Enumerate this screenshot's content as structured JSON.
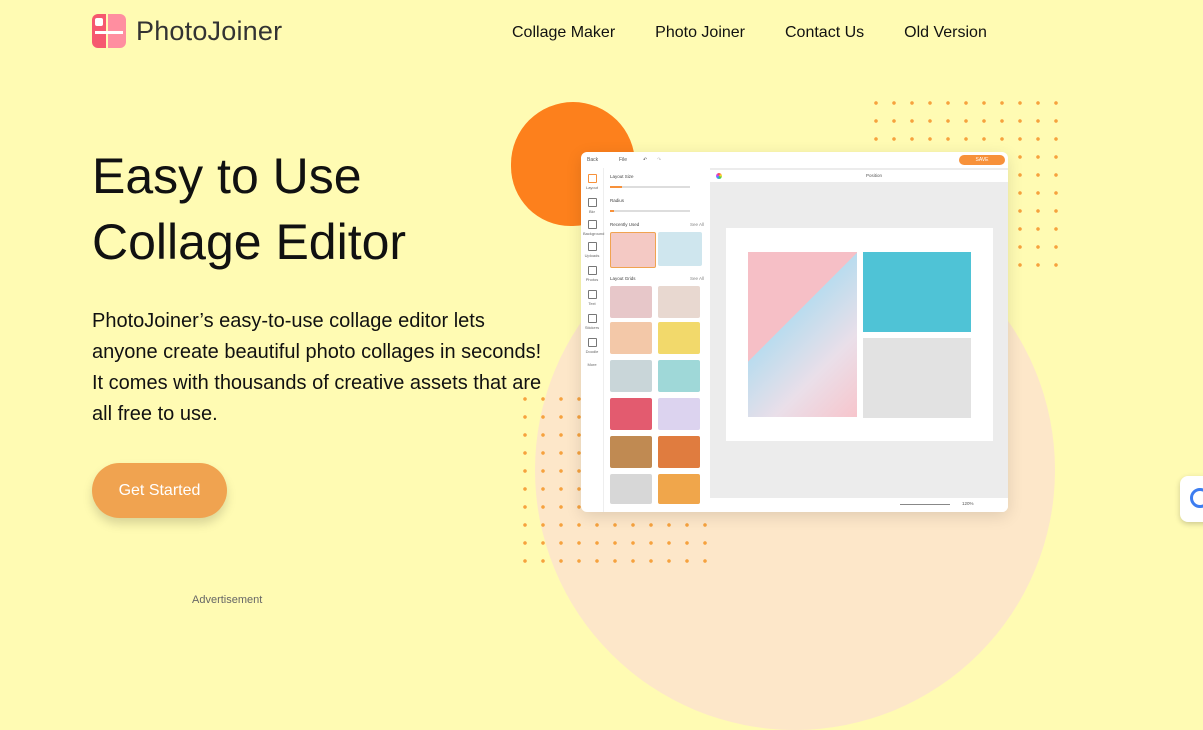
{
  "brand": {
    "name": "PhotoJoiner",
    "logo_icon": "photojoiner-logo"
  },
  "nav": [
    {
      "label": "Collage Maker"
    },
    {
      "label": "Photo Joiner"
    },
    {
      "label": "Contact Us"
    },
    {
      "label": "Old Version"
    }
  ],
  "hero": {
    "title_line1": "Easy to Use",
    "title_line2": "Collage Editor",
    "description": "PhotoJoiner’s easy-to-use collage editor lets anyone create beautiful photo collages in seconds! It comes with thousands of creative assets that are all free to use.",
    "cta_label": "Get Started"
  },
  "ad_label": "Advertisement",
  "editor": {
    "back": "Back",
    "file": "File",
    "save": "SAVE",
    "layout_size": "Layout Size",
    "radius": "Radius",
    "recently_used": "Recently Used",
    "layout_grids": "Layout Grids",
    "see_all": "See All",
    "position": "Position",
    "zoom": "120%",
    "sidebar": [
      "Layout",
      "Bkr",
      "Background",
      "Uploads",
      "Photos",
      "Text",
      "Stickers",
      "Doodle",
      "More"
    ]
  },
  "colors": {
    "background": "#fffbb3",
    "accent": "#f0a350",
    "orange_blob": "#fd801c",
    "peach": "#fde7c9"
  }
}
